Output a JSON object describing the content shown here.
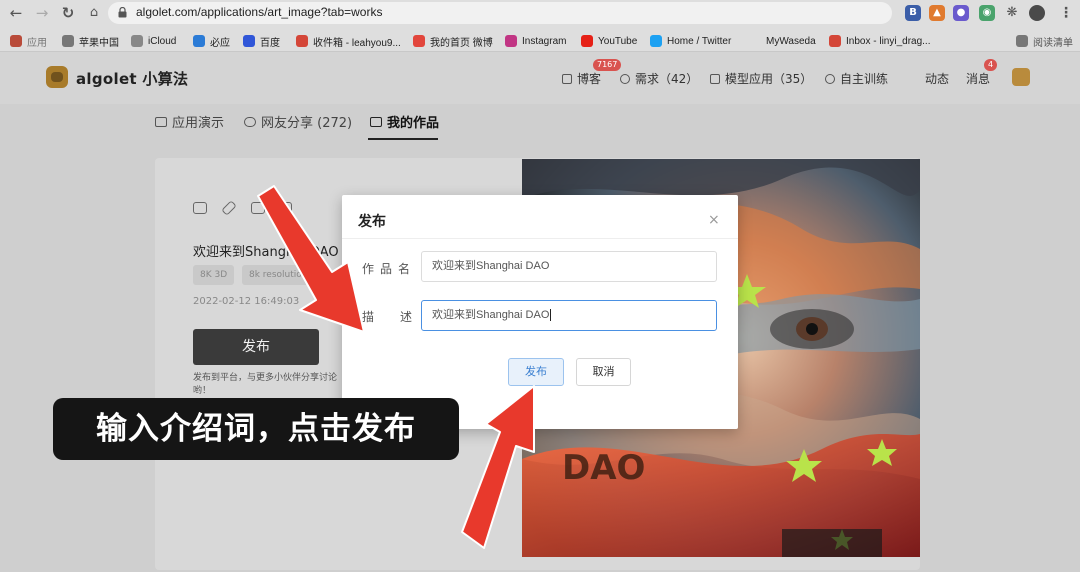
{
  "browser": {
    "url": "algolet.com/applications/art_image?tab=works",
    "bookmarks": [
      {
        "label": "应用",
        "color": "#b94b3a"
      },
      {
        "label": "苹果中国",
        "color": "#777777"
      },
      {
        "label": "iCloud",
        "color": "#888888"
      },
      {
        "label": "必应",
        "color": "#2b7bd6"
      },
      {
        "label": "百度",
        "color": "#3056d8"
      },
      {
        "label": "收件箱 - leahyou9...",
        "color": "#d44638"
      },
      {
        "label": "我的首页 微博",
        "color": "#e2463c"
      },
      {
        "label": "Instagram",
        "color": "#c13584"
      },
      {
        "label": "YouTube",
        "color": "#e62117"
      },
      {
        "label": "Home / Twitter",
        "color": "#1da1f2"
      },
      {
        "label": "MyWaseda",
        "color": "#999999"
      },
      {
        "label": "Inbox - linyi_drag...",
        "color": "#d44638"
      },
      {
        "label": "阅读清单",
        "color": "#777777"
      }
    ]
  },
  "site": {
    "name": "algolet 小算法",
    "nav": {
      "blog": "博客",
      "blog_badge": "7167",
      "needs": "需求（42）",
      "models": "模型应用（35）",
      "training": "自主训练",
      "activity": "动态",
      "messages": "消息",
      "messages_badge": "4"
    },
    "tabs": {
      "demo": "应用演示",
      "share": "网友分享 (272)",
      "mine": "我的作品"
    }
  },
  "work": {
    "title": "欢迎来到Shanghai DAO",
    "tags": [
      "8K 3D",
      "8k resolution"
    ],
    "date": "2022-02-12 16:49:03",
    "publish_label": "发布",
    "publish_note": "发布到平台，与更多小伙伴分享讨论哟！"
  },
  "modal": {
    "title": "发布",
    "close_glyph": "×",
    "name_label": "作品名",
    "name_value": "欢迎来到Shanghai DAO",
    "desc_label": "描述",
    "desc_value": "欢迎来到Shanghai DAO",
    "submit_label": "发布",
    "cancel_label": "取消"
  },
  "annotation": {
    "caption": "输入介绍词，点击发布",
    "arrow_color": "#e8392c"
  }
}
